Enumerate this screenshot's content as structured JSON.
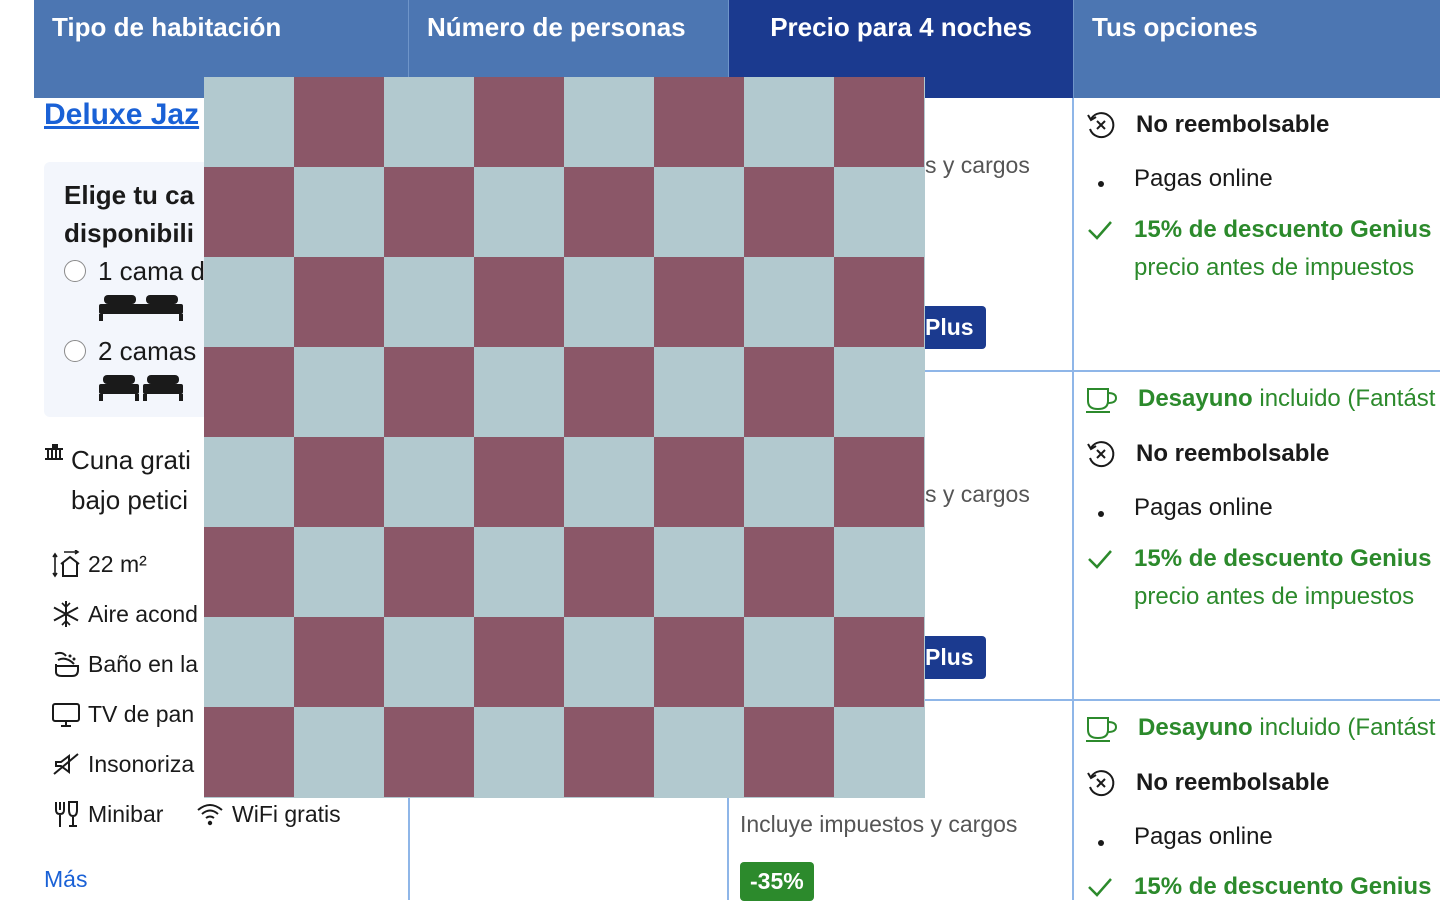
{
  "header": {
    "room_type": "Tipo de habitación",
    "guests": "Número de personas",
    "price": "Precio para 4 noches",
    "options": "Tus opciones"
  },
  "room": {
    "name": "Deluxe Jaz",
    "bed_prompt": "Elige tu ca\ndisponibili",
    "bed_options": [
      "1 cama d",
      "2 camas"
    ],
    "crib": "Cuna grati\nbajo petici",
    "facilities": [
      {
        "icon": "room-size-icon",
        "label": "22 m²"
      },
      {
        "icon": "snowflake-icon",
        "label": "Aire acond"
      },
      {
        "icon": "bath-icon",
        "label": "Baño en la"
      },
      {
        "icon": "tv-icon",
        "label": "TV de pan"
      },
      {
        "icon": "soundproof-icon",
        "label": "Insonoriza"
      },
      {
        "icon": "minibar-icon",
        "label": "Minibar"
      },
      {
        "icon": "wifi-icon",
        "label": "WiFi gratis"
      }
    ],
    "more": "Más"
  },
  "prices": {
    "taxes_partial": "s y cargos",
    "taxes_full": "Incluye impuestos y cargos",
    "genius_partial": "Plus",
    "discount": "-35%"
  },
  "options": {
    "non_refundable": "No reembolsable",
    "pay_online": "Pagas online",
    "genius_discount": "15% de descuento Genius",
    "price_before_tax": "precio antes de impuestos",
    "breakfast_bold": "Desayuno",
    "breakfast_rest": " incluido (Fantást"
  },
  "colors": {
    "header": "#4c76b2",
    "header_active": "#1b3a8f",
    "link": "#1a61d6",
    "green": "#2c8a2c",
    "checker_light": "#b2c9cf",
    "checker_dark": "#8b5768"
  }
}
